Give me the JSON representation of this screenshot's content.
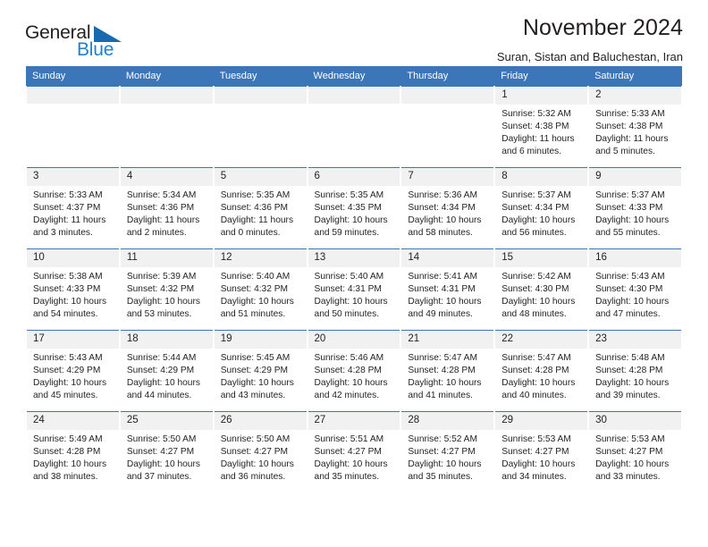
{
  "brand": {
    "name_part1": "General",
    "name_part2": "Blue",
    "triangle_icon": "triangle-icon",
    "accent_color": "#1769b0",
    "blue_text_color": "#1f7fd0"
  },
  "header": {
    "title": "November 2024",
    "subtitle": "Suran, Sistan and Baluchestan, Iran"
  },
  "theme": {
    "header_blue": "#3b76b8",
    "daynum_bg": "#f1f1f1",
    "text": "#231f20"
  },
  "weekdays": [
    "Sunday",
    "Monday",
    "Tuesday",
    "Wednesday",
    "Thursday",
    "Friday",
    "Saturday"
  ],
  "weeks": [
    [
      {
        "day": "",
        "blank": true
      },
      {
        "day": "",
        "blank": true
      },
      {
        "day": "",
        "blank": true
      },
      {
        "day": "",
        "blank": true
      },
      {
        "day": "",
        "blank": true
      },
      {
        "day": "1",
        "sunrise": "Sunrise: 5:32 AM",
        "sunset": "Sunset: 4:38 PM",
        "daylight": "Daylight: 11 hours and 6 minutes."
      },
      {
        "day": "2",
        "sunrise": "Sunrise: 5:33 AM",
        "sunset": "Sunset: 4:38 PM",
        "daylight": "Daylight: 11 hours and 5 minutes."
      }
    ],
    [
      {
        "day": "3",
        "sunrise": "Sunrise: 5:33 AM",
        "sunset": "Sunset: 4:37 PM",
        "daylight": "Daylight: 11 hours and 3 minutes."
      },
      {
        "day": "4",
        "sunrise": "Sunrise: 5:34 AM",
        "sunset": "Sunset: 4:36 PM",
        "daylight": "Daylight: 11 hours and 2 minutes."
      },
      {
        "day": "5",
        "sunrise": "Sunrise: 5:35 AM",
        "sunset": "Sunset: 4:36 PM",
        "daylight": "Daylight: 11 hours and 0 minutes."
      },
      {
        "day": "6",
        "sunrise": "Sunrise: 5:35 AM",
        "sunset": "Sunset: 4:35 PM",
        "daylight": "Daylight: 10 hours and 59 minutes."
      },
      {
        "day": "7",
        "sunrise": "Sunrise: 5:36 AM",
        "sunset": "Sunset: 4:34 PM",
        "daylight": "Daylight: 10 hours and 58 minutes."
      },
      {
        "day": "8",
        "sunrise": "Sunrise: 5:37 AM",
        "sunset": "Sunset: 4:34 PM",
        "daylight": "Daylight: 10 hours and 56 minutes."
      },
      {
        "day": "9",
        "sunrise": "Sunrise: 5:37 AM",
        "sunset": "Sunset: 4:33 PM",
        "daylight": "Daylight: 10 hours and 55 minutes."
      }
    ],
    [
      {
        "day": "10",
        "sunrise": "Sunrise: 5:38 AM",
        "sunset": "Sunset: 4:33 PM",
        "daylight": "Daylight: 10 hours and 54 minutes."
      },
      {
        "day": "11",
        "sunrise": "Sunrise: 5:39 AM",
        "sunset": "Sunset: 4:32 PM",
        "daylight": "Daylight: 10 hours and 53 minutes."
      },
      {
        "day": "12",
        "sunrise": "Sunrise: 5:40 AM",
        "sunset": "Sunset: 4:32 PM",
        "daylight": "Daylight: 10 hours and 51 minutes."
      },
      {
        "day": "13",
        "sunrise": "Sunrise: 5:40 AM",
        "sunset": "Sunset: 4:31 PM",
        "daylight": "Daylight: 10 hours and 50 minutes."
      },
      {
        "day": "14",
        "sunrise": "Sunrise: 5:41 AM",
        "sunset": "Sunset: 4:31 PM",
        "daylight": "Daylight: 10 hours and 49 minutes."
      },
      {
        "day": "15",
        "sunrise": "Sunrise: 5:42 AM",
        "sunset": "Sunset: 4:30 PM",
        "daylight": "Daylight: 10 hours and 48 minutes."
      },
      {
        "day": "16",
        "sunrise": "Sunrise: 5:43 AM",
        "sunset": "Sunset: 4:30 PM",
        "daylight": "Daylight: 10 hours and 47 minutes."
      }
    ],
    [
      {
        "day": "17",
        "sunrise": "Sunrise: 5:43 AM",
        "sunset": "Sunset: 4:29 PM",
        "daylight": "Daylight: 10 hours and 45 minutes."
      },
      {
        "day": "18",
        "sunrise": "Sunrise: 5:44 AM",
        "sunset": "Sunset: 4:29 PM",
        "daylight": "Daylight: 10 hours and 44 minutes."
      },
      {
        "day": "19",
        "sunrise": "Sunrise: 5:45 AM",
        "sunset": "Sunset: 4:29 PM",
        "daylight": "Daylight: 10 hours and 43 minutes."
      },
      {
        "day": "20",
        "sunrise": "Sunrise: 5:46 AM",
        "sunset": "Sunset: 4:28 PM",
        "daylight": "Daylight: 10 hours and 42 minutes."
      },
      {
        "day": "21",
        "sunrise": "Sunrise: 5:47 AM",
        "sunset": "Sunset: 4:28 PM",
        "daylight": "Daylight: 10 hours and 41 minutes."
      },
      {
        "day": "22",
        "sunrise": "Sunrise: 5:47 AM",
        "sunset": "Sunset: 4:28 PM",
        "daylight": "Daylight: 10 hours and 40 minutes."
      },
      {
        "day": "23",
        "sunrise": "Sunrise: 5:48 AM",
        "sunset": "Sunset: 4:28 PM",
        "daylight": "Daylight: 10 hours and 39 minutes."
      }
    ],
    [
      {
        "day": "24",
        "sunrise": "Sunrise: 5:49 AM",
        "sunset": "Sunset: 4:28 PM",
        "daylight": "Daylight: 10 hours and 38 minutes."
      },
      {
        "day": "25",
        "sunrise": "Sunrise: 5:50 AM",
        "sunset": "Sunset: 4:27 PM",
        "daylight": "Daylight: 10 hours and 37 minutes."
      },
      {
        "day": "26",
        "sunrise": "Sunrise: 5:50 AM",
        "sunset": "Sunset: 4:27 PM",
        "daylight": "Daylight: 10 hours and 36 minutes."
      },
      {
        "day": "27",
        "sunrise": "Sunrise: 5:51 AM",
        "sunset": "Sunset: 4:27 PM",
        "daylight": "Daylight: 10 hours and 35 minutes."
      },
      {
        "day": "28",
        "sunrise": "Sunrise: 5:52 AM",
        "sunset": "Sunset: 4:27 PM",
        "daylight": "Daylight: 10 hours and 35 minutes."
      },
      {
        "day": "29",
        "sunrise": "Sunrise: 5:53 AM",
        "sunset": "Sunset: 4:27 PM",
        "daylight": "Daylight: 10 hours and 34 minutes."
      },
      {
        "day": "30",
        "sunrise": "Sunrise: 5:53 AM",
        "sunset": "Sunset: 4:27 PM",
        "daylight": "Daylight: 10 hours and 33 minutes."
      }
    ]
  ]
}
